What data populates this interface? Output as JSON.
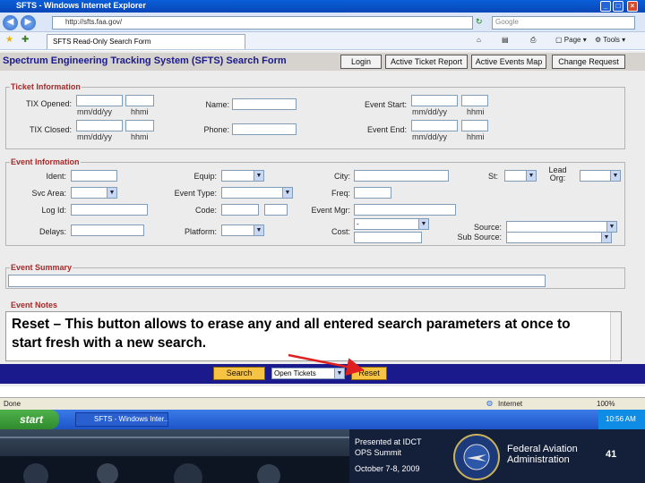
{
  "browser": {
    "window_title": "SFTS - Windows Internet Explorer",
    "address": "http://sfts.faa.gov/",
    "search_placeholder": "Google",
    "tab_title": "SFTS Read-Only Search Form",
    "page_label": "Page",
    "tools_label": "Tools",
    "status_left": "Done",
    "status_zone": "Internet",
    "zoom": "100%"
  },
  "app": {
    "title": "Spectrum Engineering Tracking System (SFTS) Search Form",
    "header_buttons": [
      "Login",
      "Active Ticket Report",
      "Active Events Map",
      "Change Request"
    ]
  },
  "ticket_info": {
    "legend": "Ticket Information",
    "tix_opened_label": "TIX Opened:",
    "tix_closed_label": "TIX Closed:",
    "date_hint": "mm/dd/yy",
    "time_hint": "hhmi",
    "name_label": "Name:",
    "phone_label": "Phone:",
    "event_start_label": "Event Start:",
    "event_end_label": "Event End:"
  },
  "event_info": {
    "legend": "Event Information",
    "ident_label": "Ident:",
    "svc_area_label": "Svc Area:",
    "log_id_label": "Log Id:",
    "delays_label": "Delays:",
    "equip_label": "Equip:",
    "event_type_label": "Event Type:",
    "code_label": "Code:",
    "platform_label": "Platform:",
    "city_label": "City:",
    "freq_label": "Freq:",
    "event_mgr_label": "Event Mgr:",
    "cost_label": "Cost:",
    "cost_value": "-",
    "st_label": "St:",
    "lead_org_label": "Lead\nOrg:",
    "source_label": "Source:",
    "sub_source_label": "Sub Source:"
  },
  "event_summary": {
    "legend": "Event Summary"
  },
  "event_notes": {
    "legend": "Event Notes",
    "callout": "Reset – This button allows to erase any and all entered search parameters at once to start fresh with a new search."
  },
  "bottom": {
    "search_label": "Search",
    "ticket_select": "Open Tickets",
    "reset_label": "Reset"
  },
  "taskbar": {
    "start_label": "start",
    "task_item": "SFTS - Windows Inter...",
    "clock": "10:56 AM"
  },
  "footer": {
    "presented": "Presented at IDCT\nOPS Summit",
    "date": "October 7-8, 2009",
    "agency": "Federal Aviation\nAdministration",
    "slide_number": "41"
  },
  "colors": {
    "legend_red": "#a52a2a",
    "title_blue": "#1a1a8c",
    "bottom_bar": "#1a1a8c",
    "button_gold": "#f6c343",
    "arrow_red": "#e02020"
  }
}
